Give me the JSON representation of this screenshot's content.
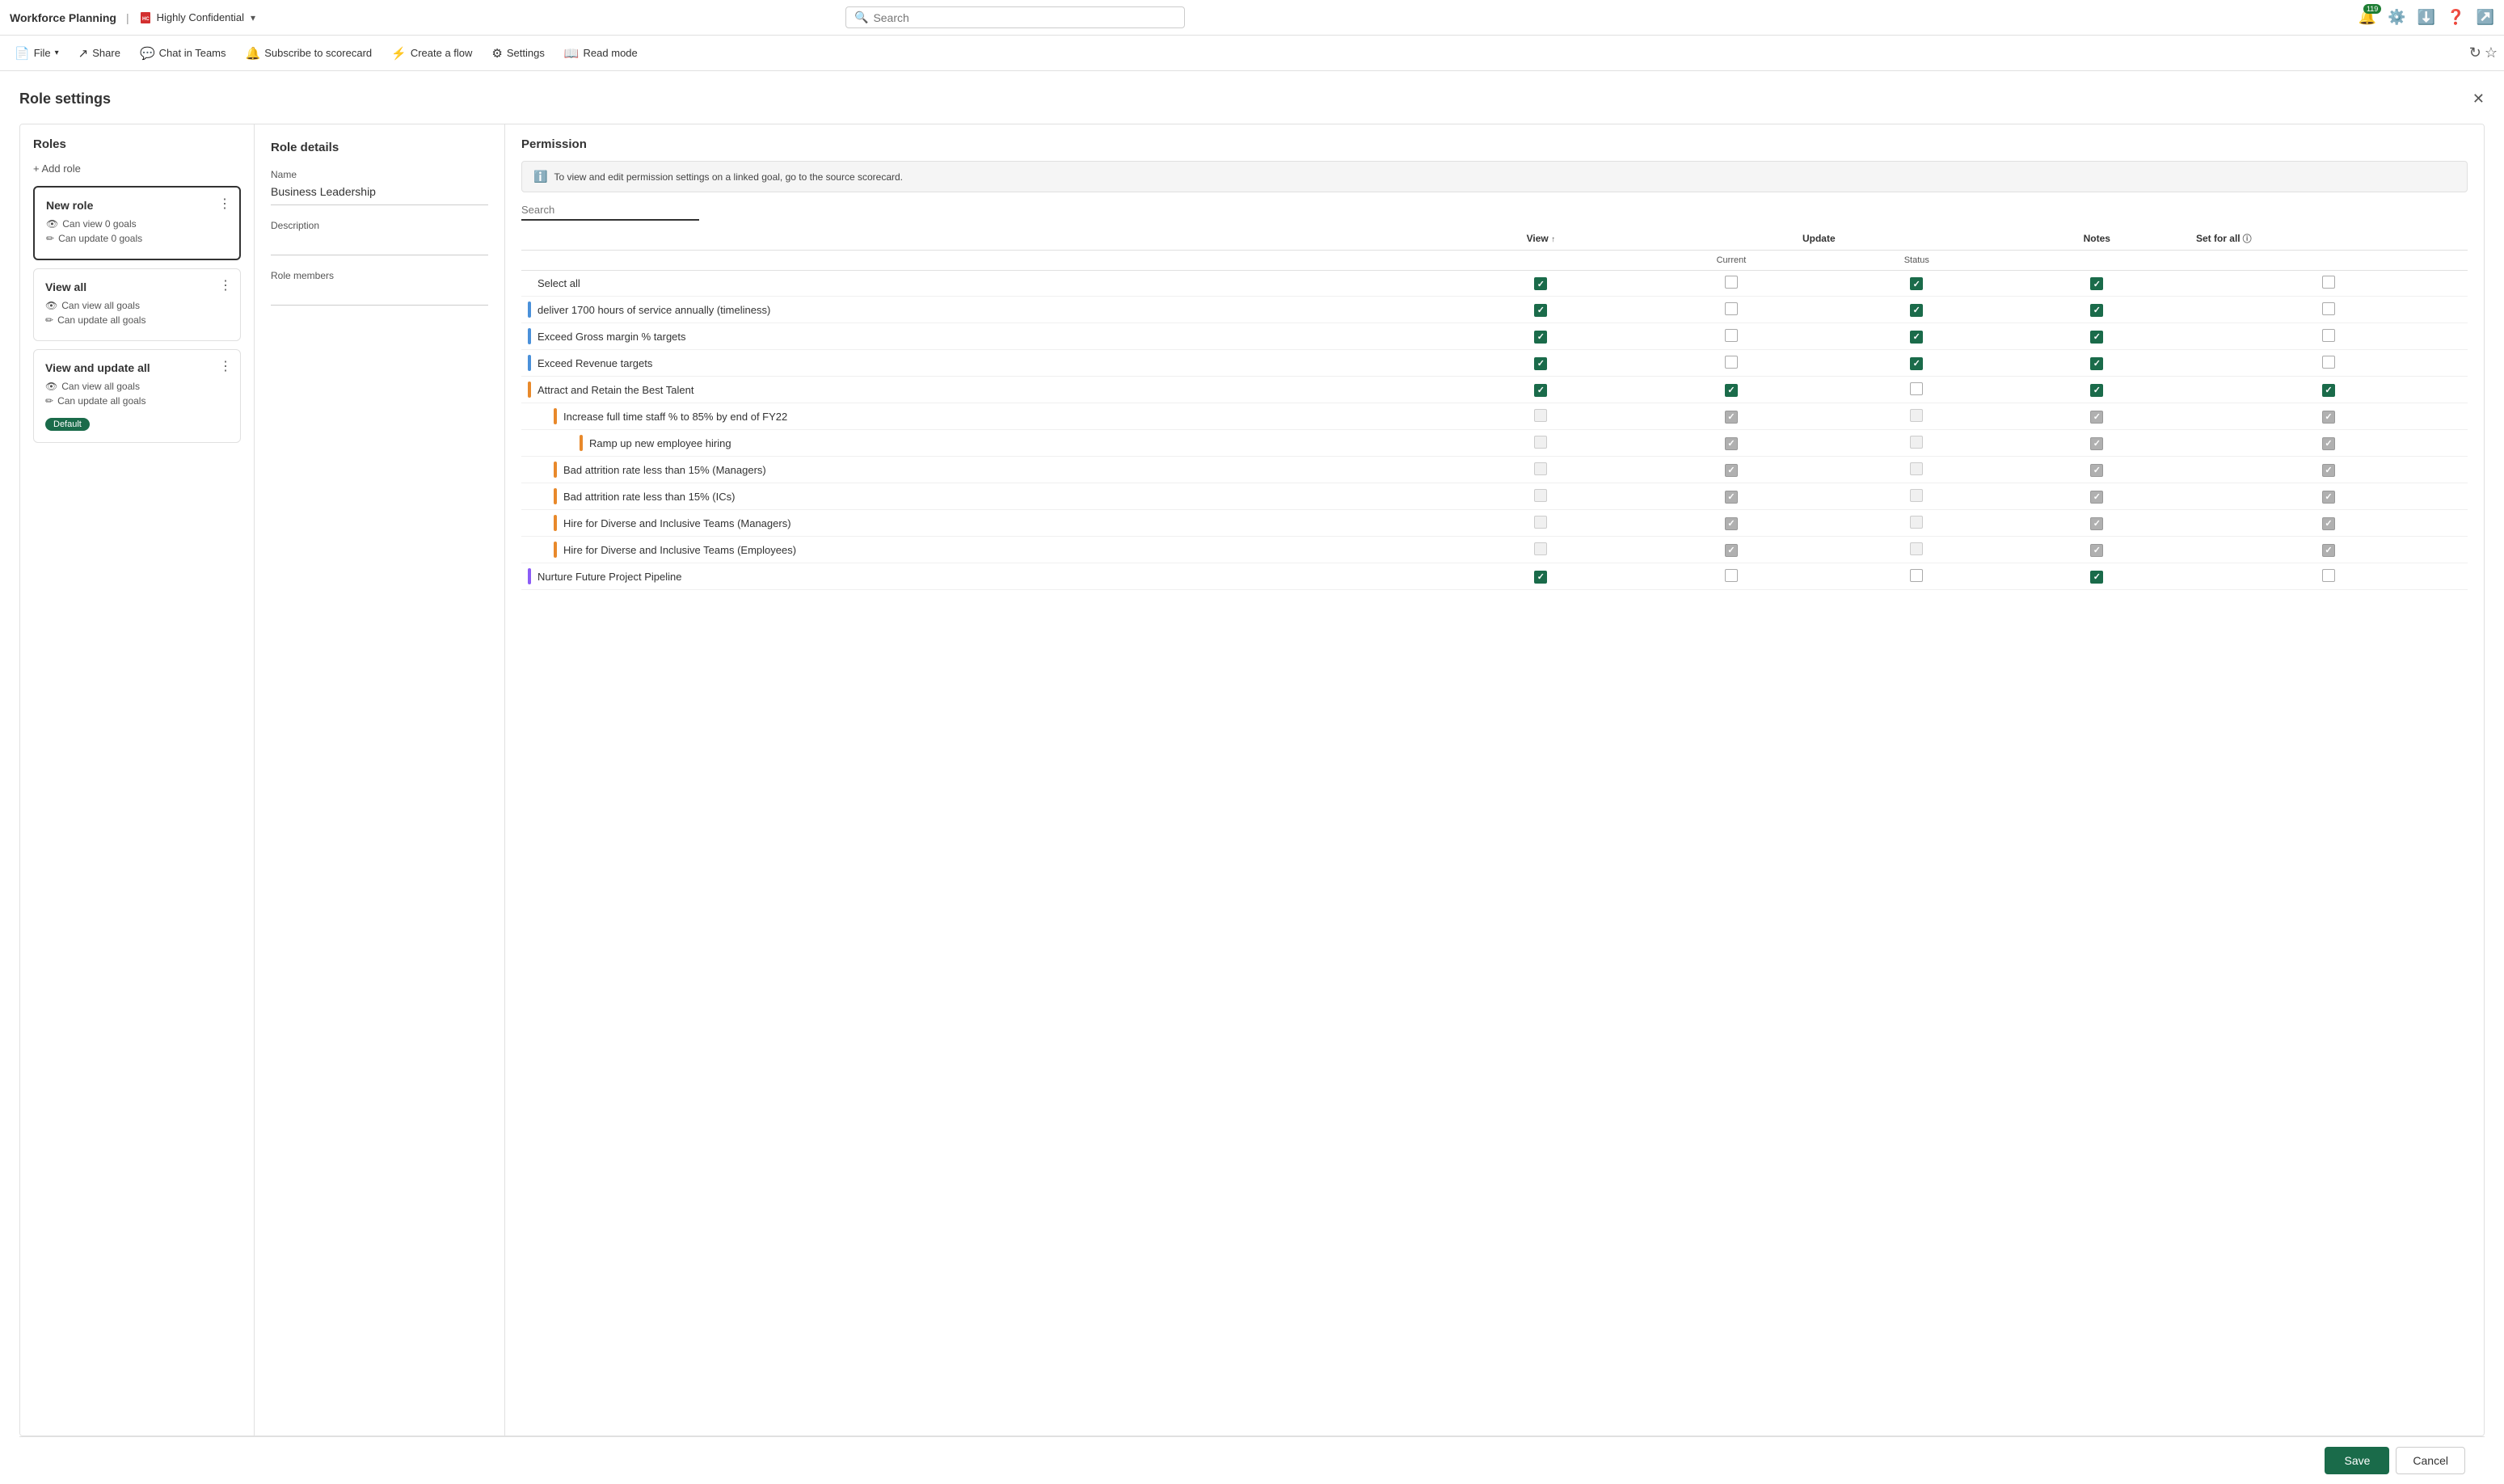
{
  "topbar": {
    "title": "Workforce Planning",
    "separator": "|",
    "doc_title": "Highly Confidential",
    "search_placeholder": "Search",
    "notification_count": "119",
    "icons": {
      "settings": "⚙",
      "download": "⬇",
      "help": "?",
      "share": "⟳"
    }
  },
  "toolbar": {
    "file_label": "File",
    "share_label": "Share",
    "chat_label": "Chat in Teams",
    "subscribe_label": "Subscribe to scorecard",
    "flow_label": "Create a flow",
    "settings_label": "Settings",
    "read_label": "Read mode",
    "refresh_icon": "↻",
    "star_icon": "☆"
  },
  "dialog": {
    "title": "Role settings",
    "close_icon": "✕"
  },
  "roles_panel": {
    "title": "Roles",
    "add_role_label": "+ Add role",
    "cards": [
      {
        "name": "New role",
        "can_view": "Can view 0 goals",
        "can_update": "Can update 0 goals",
        "is_selected": true,
        "is_default": false
      },
      {
        "name": "View all",
        "can_view": "Can view all goals",
        "can_update": "Can update all goals",
        "is_selected": false,
        "is_default": false
      },
      {
        "name": "View and update all",
        "can_view": "Can view all goals",
        "can_update": "Can update all goals",
        "is_selected": false,
        "is_default": true,
        "default_label": "Default"
      }
    ]
  },
  "role_details": {
    "title": "Role details",
    "name_label": "Name",
    "name_value": "Business Leadership",
    "desc_label": "Description",
    "desc_value": "",
    "members_label": "Role members",
    "members_value": ""
  },
  "permission": {
    "title": "Permission",
    "info_text": "To view and edit permission settings on a linked goal, go to the source scorecard.",
    "search_placeholder": "Search",
    "columns": {
      "view": "View",
      "update": "Update",
      "current": "Current",
      "status": "Status",
      "notes": "Notes",
      "set_for_all": "Set for all"
    },
    "goals": [
      {
        "label": "Select all",
        "level": 0,
        "bar_color": "",
        "view": "checked",
        "current": "unchecked",
        "status": "checked",
        "notes": "checked",
        "set_for_all": "unchecked"
      },
      {
        "label": "deliver 1700 hours of service annually (timeliness)",
        "level": 1,
        "bar_color": "blue",
        "view": "checked",
        "current": "unchecked",
        "status": "checked",
        "notes": "checked",
        "set_for_all": "unchecked"
      },
      {
        "label": "Exceed Gross margin % targets",
        "level": 1,
        "bar_color": "blue",
        "view": "checked",
        "current": "unchecked",
        "status": "checked",
        "notes": "checked",
        "set_for_all": "unchecked"
      },
      {
        "label": "Exceed Revenue targets",
        "level": 1,
        "bar_color": "blue",
        "view": "checked",
        "current": "unchecked",
        "status": "checked",
        "notes": "checked",
        "set_for_all": "unchecked"
      },
      {
        "label": "Attract and Retain the Best Talent",
        "level": 1,
        "bar_color": "orange",
        "view": "checked",
        "current": "checked",
        "status": "unchecked",
        "notes": "checked",
        "set_for_all": "checked"
      },
      {
        "label": "Increase full time staff % to 85% by end of FY22",
        "level": 2,
        "bar_color": "orange",
        "view": "disabled",
        "current": "disabled-checked",
        "status": "disabled",
        "notes": "disabled-checked",
        "set_for_all": "disabled-checked"
      },
      {
        "label": "Ramp up new employee hiring",
        "level": 3,
        "bar_color": "orange",
        "view": "disabled",
        "current": "disabled-checked",
        "status": "disabled",
        "notes": "disabled-checked",
        "set_for_all": "disabled-checked"
      },
      {
        "label": "Bad attrition rate less than 15% (Managers)",
        "level": 2,
        "bar_color": "orange",
        "view": "disabled",
        "current": "disabled-checked",
        "status": "disabled",
        "notes": "disabled-checked",
        "set_for_all": "disabled-checked"
      },
      {
        "label": "Bad attrition rate less than 15% (ICs)",
        "level": 2,
        "bar_color": "orange",
        "view": "disabled",
        "current": "disabled-checked",
        "status": "disabled",
        "notes": "disabled-checked",
        "set_for_all": "disabled-checked"
      },
      {
        "label": "Hire for Diverse and Inclusive Teams (Managers)",
        "level": 2,
        "bar_color": "orange",
        "view": "disabled",
        "current": "disabled-checked",
        "status": "disabled",
        "notes": "disabled-checked",
        "set_for_all": "disabled-checked"
      },
      {
        "label": "Hire for Diverse and Inclusive Teams (Employees)",
        "level": 2,
        "bar_color": "orange",
        "view": "disabled",
        "current": "disabled-checked",
        "status": "disabled",
        "notes": "disabled-checked",
        "set_for_all": "disabled-checked"
      },
      {
        "label": "Nurture Future Project Pipeline",
        "level": 1,
        "bar_color": "purple",
        "view": "checked",
        "current": "unchecked",
        "status": "unchecked",
        "notes": "checked",
        "set_for_all": "unchecked"
      }
    ]
  },
  "footer": {
    "save_label": "Save",
    "cancel_label": "Cancel"
  }
}
